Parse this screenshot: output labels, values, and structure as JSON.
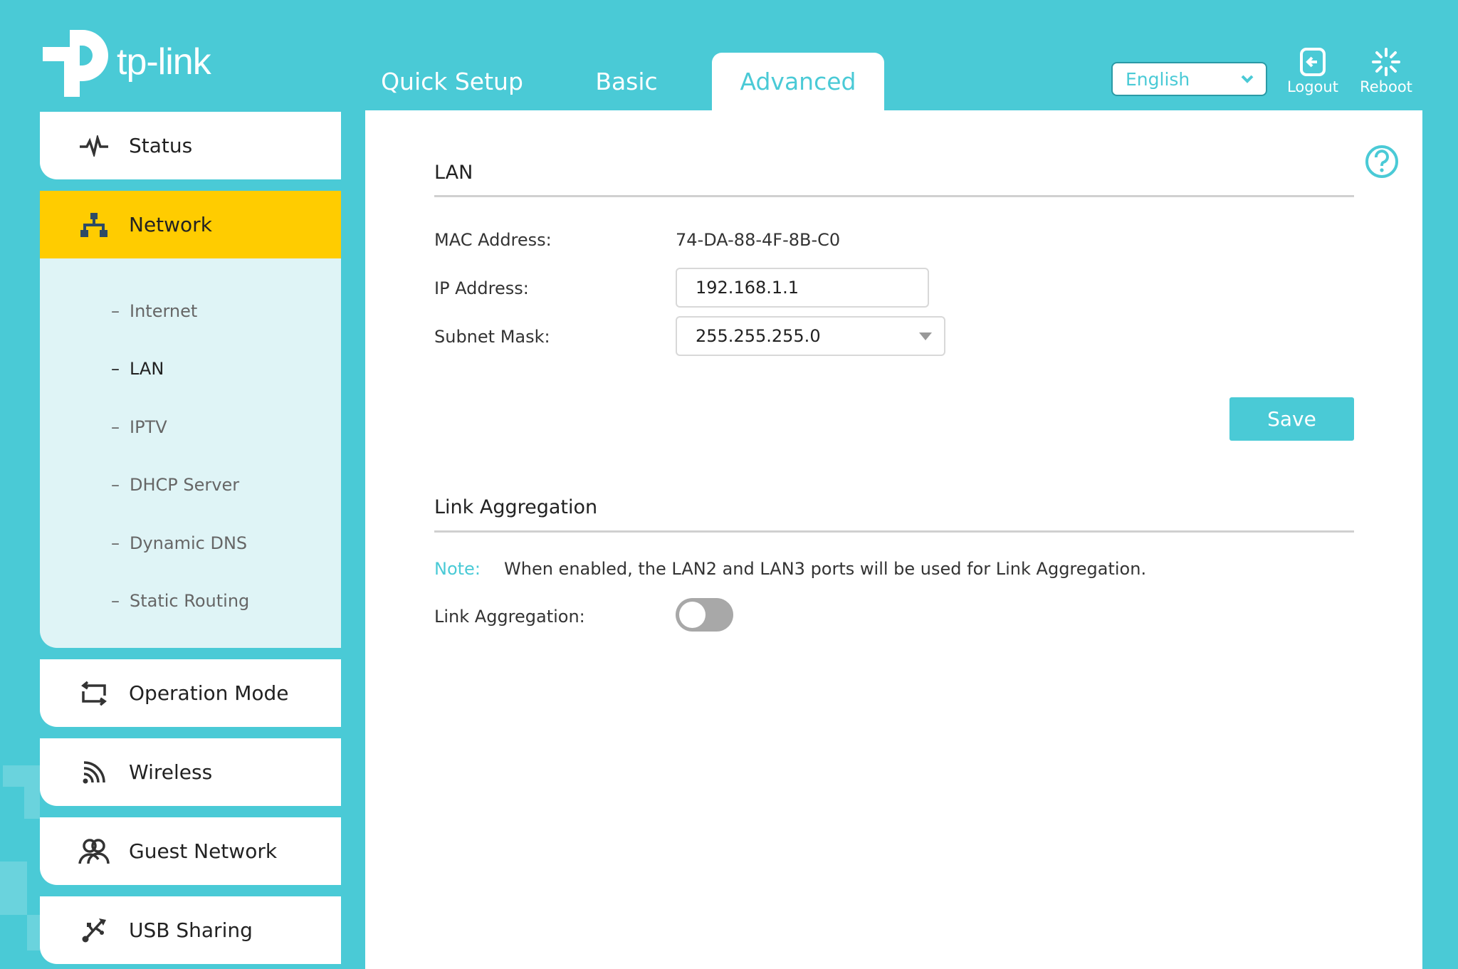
{
  "brand": {
    "logo_text": "tp-link",
    "accent": "#4acad6",
    "highlight": "#ffcc00"
  },
  "tabs": [
    {
      "label": "Quick Setup",
      "active": false
    },
    {
      "label": "Basic",
      "active": false
    },
    {
      "label": "Advanced",
      "active": true
    }
  ],
  "header": {
    "language": "English",
    "logout_label": "Logout",
    "reboot_label": "Reboot"
  },
  "sidebar": {
    "items": [
      {
        "label": "Status",
        "icon": "pulse-icon"
      },
      {
        "label": "Network",
        "icon": "network-icon",
        "active": true
      },
      {
        "label": "Operation Mode",
        "icon": "operation-mode-icon"
      },
      {
        "label": "Wireless",
        "icon": "wireless-icon"
      },
      {
        "label": "Guest Network",
        "icon": "users-icon"
      },
      {
        "label": "USB Sharing",
        "icon": "usb-icon"
      }
    ],
    "subitems": [
      {
        "label": "Internet"
      },
      {
        "label": "LAN",
        "active": true
      },
      {
        "label": "IPTV"
      },
      {
        "label": "DHCP Server"
      },
      {
        "label": "Dynamic DNS"
      },
      {
        "label": "Static Routing"
      }
    ]
  },
  "lan": {
    "title": "LAN",
    "mac_label": "MAC Address:",
    "mac_value": "74-DA-88-4F-8B-C0",
    "ip_label": "IP Address:",
    "ip_value": "192.168.1.1",
    "mask_label": "Subnet Mask:",
    "mask_value": "255.255.255.0",
    "save_label": "Save"
  },
  "link_aggregation": {
    "title": "Link Aggregation",
    "note_label": "Note:",
    "note_text": "When enabled, the LAN2 and LAN3 ports will be used for Link Aggregation.",
    "toggle_label": "Link Aggregation:",
    "enabled": false
  }
}
